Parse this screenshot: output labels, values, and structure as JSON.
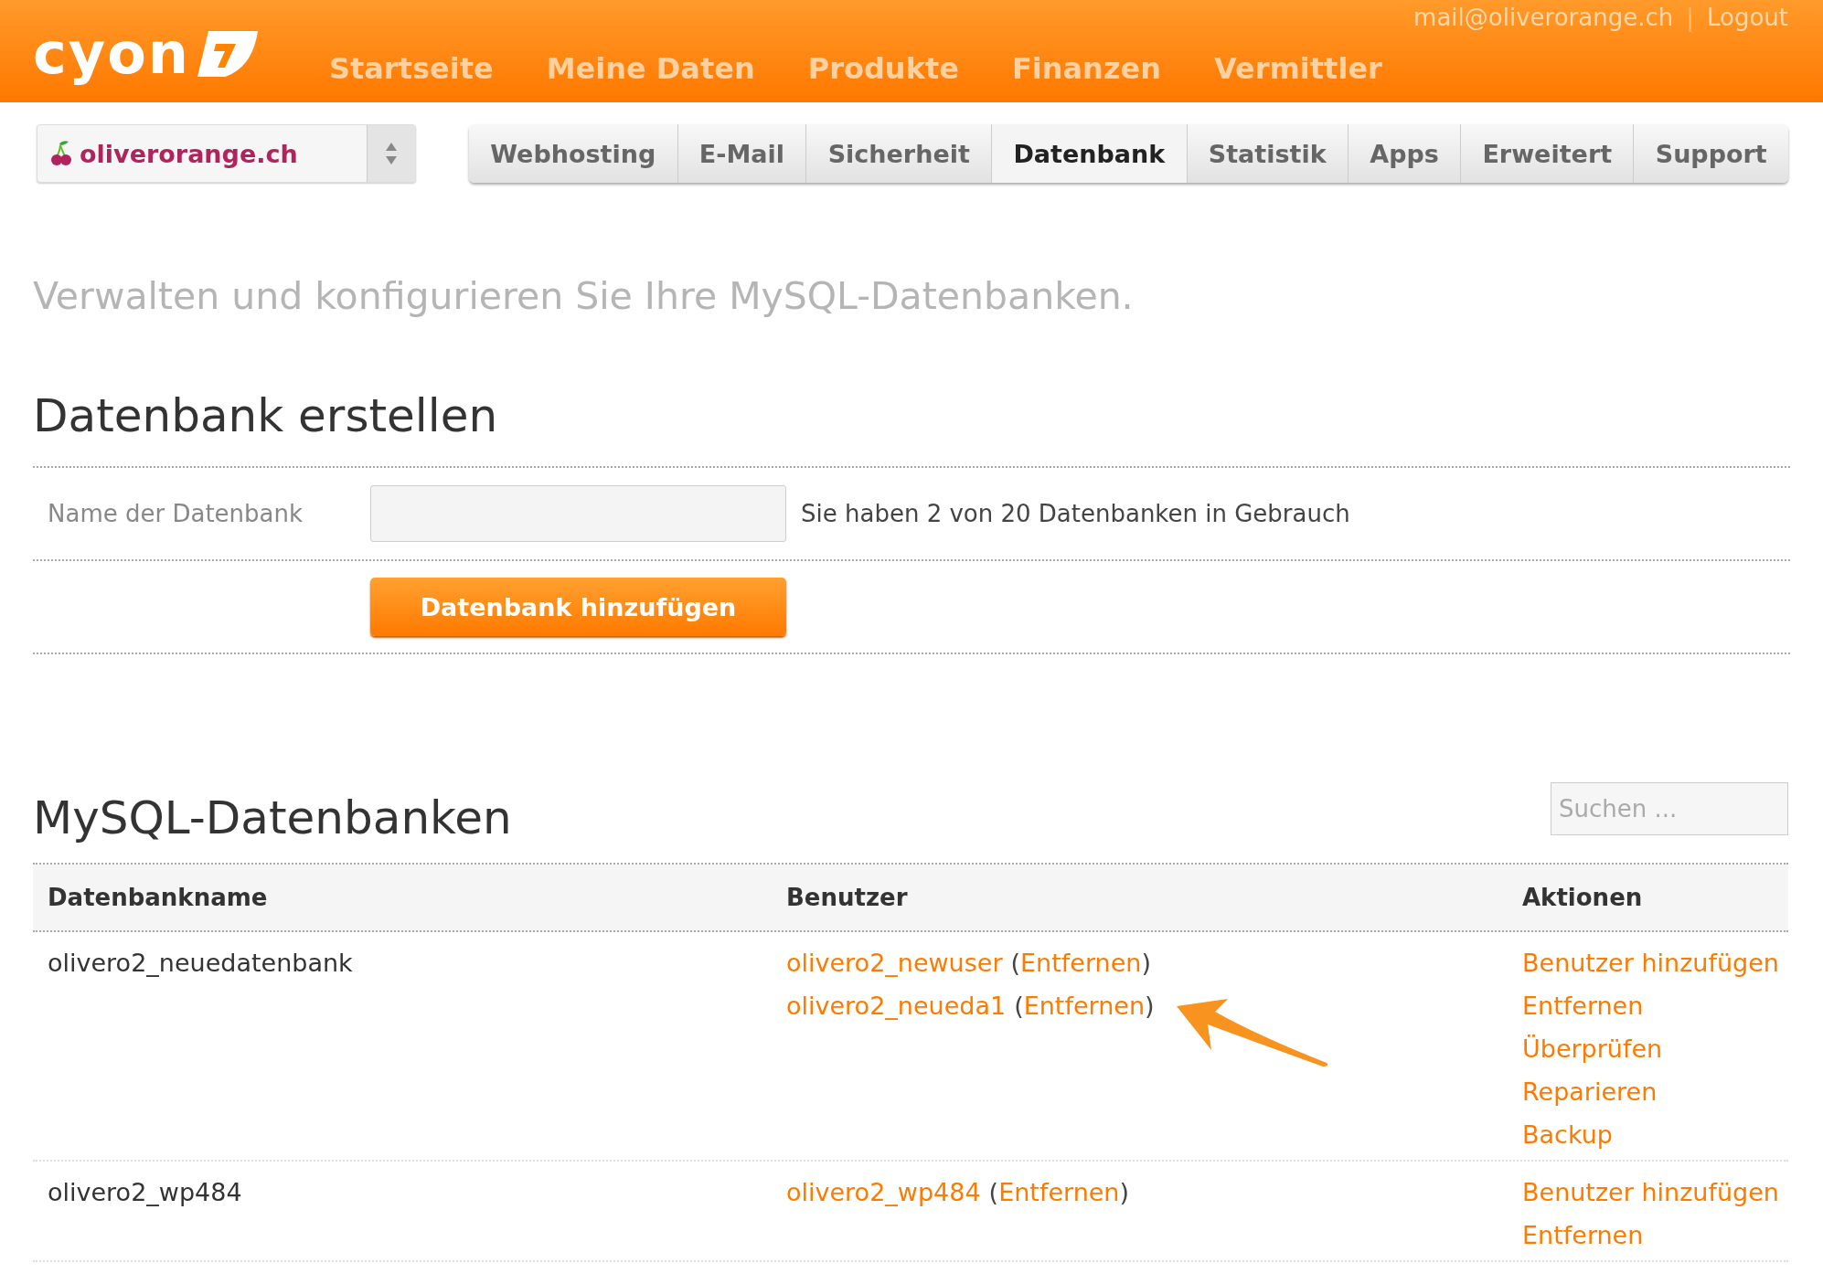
{
  "header": {
    "logo": "cyon",
    "nav": [
      "Startseite",
      "Meine Daten",
      "Produkte",
      "Finanzen",
      "Vermittler"
    ],
    "account": "mail@oliverorange.ch",
    "separator": "|",
    "logout": "Logout"
  },
  "domain_select": {
    "value": "oliverorange.ch"
  },
  "tabs": [
    {
      "label": "Webhosting",
      "selected": false
    },
    {
      "label": "E-Mail",
      "selected": false
    },
    {
      "label": "Sicherheit",
      "selected": false
    },
    {
      "label": "Datenbank",
      "selected": true
    },
    {
      "label": "Statistik",
      "selected": false
    },
    {
      "label": "Apps",
      "selected": false
    },
    {
      "label": "Erweitert",
      "selected": false
    },
    {
      "label": "Support",
      "selected": false
    }
  ],
  "intro": "Verwalten und konfigurieren Sie Ihre MySQL-Datenbanken.",
  "create": {
    "heading": "Datenbank erstellen",
    "field_label": "Name der Datenbank",
    "usage": "Sie haben 2 von 20 Datenbanken in Gebrauch",
    "button": "Datenbank hinzufügen"
  },
  "list": {
    "heading": "MySQL-Datenbanken",
    "search": {
      "placeholder": "Suchen ..."
    },
    "columns": [
      "Datenbankname",
      "Benutzer",
      "Aktionen"
    ],
    "rows": [
      {
        "name": "olivero2_neuedatenbank",
        "users": [
          {
            "name": "olivero2_newuser",
            "open": "(",
            "action": "Entfernen",
            "close": ")",
            "arrow": false
          },
          {
            "name": "olivero2_neueda1",
            "open": "(",
            "action": "Entfernen",
            "close": ")",
            "arrow": true
          }
        ],
        "actions": [
          "Benutzer hinzufügen",
          "Entfernen",
          "Überprüfen",
          "Reparieren",
          "Backup"
        ]
      },
      {
        "name": "olivero2_wp484",
        "users": [
          {
            "name": "olivero2_wp484",
            "open": "(",
            "action": "Entfernen",
            "close": ")",
            "arrow": false
          }
        ],
        "actions": [
          "Benutzer hinzufügen",
          "Entfernen"
        ]
      }
    ]
  }
}
